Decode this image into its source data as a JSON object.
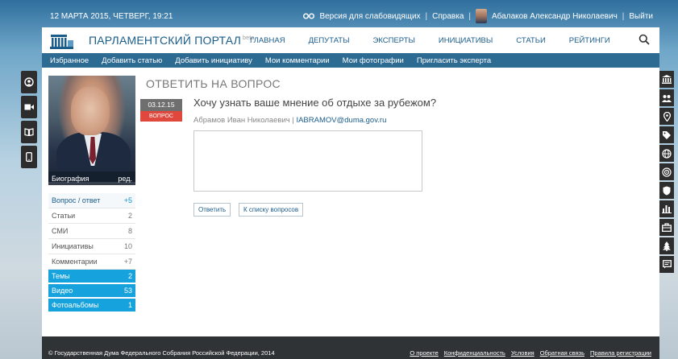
{
  "topbar": {
    "date": "12 МАРТА 2015, ЧЕТВЕРГ, 19:21",
    "low_vision": "Версия для слабовидящих",
    "help": "Справка",
    "user_name": "Абалаков Александр Николаевич",
    "logout": "Выйти",
    "separator": "|"
  },
  "header": {
    "title": "ПАРЛАМЕНТСКИЙ ПОРТАЛ",
    "beta": "beta",
    "nav": [
      "ГЛАВНАЯ",
      "ДЕПУТАТЫ",
      "ЭКСПЕРТЫ",
      "ИНИЦИАТИВЫ",
      "СТАТЬИ",
      "РЕЙТИНГИ"
    ]
  },
  "subnav": [
    "Избранное",
    "Добавить статью",
    "Добавить инициативу",
    "Мои комментарии",
    "Мои фотографии",
    "Пригласить эксперта"
  ],
  "profile": {
    "bio_label": "Биография",
    "edit_label": "ред.",
    "menu": [
      {
        "label": "Вопрос / ответ",
        "count": "+5"
      },
      {
        "label": "Статьи",
        "count": "2"
      },
      {
        "label": "СМИ",
        "count": "8"
      },
      {
        "label": "Инициативы",
        "count": "10"
      },
      {
        "label": "Комментарии",
        "count": "+7"
      },
      {
        "label": "Темы",
        "count": "2"
      },
      {
        "label": "Видео",
        "count": "53"
      },
      {
        "label": "Фотоальбомы",
        "count": "1"
      }
    ]
  },
  "main": {
    "heading": "ОТВЕТИТЬ НА ВОПРОС",
    "date": "03.12.15",
    "type": "ВОПРОС",
    "question": "Хочу узнать ваше мнение об отдыхе за рубежом?",
    "author": "Абрамов Иван Николаевич",
    "author_sep": " | ",
    "author_email": "IABRAMOV@duma.gov.ru",
    "answer_value": "",
    "answer_button": "Ответить",
    "back_button": "К списку вопросов"
  },
  "footer": {
    "copyright": "© Государственная Дума Федерального Собрания Российской Федерации, 2014",
    "links": [
      "О проекте",
      "Конфиденциальность",
      "Условия",
      "Обратная связь",
      "Правила регистрации"
    ]
  },
  "colors": {
    "brand_blue": "#1a5c8a",
    "subnav_bg": "#2e6b93",
    "accent_cyan": "#16a2dc",
    "badge_red": "#e0483d",
    "footer_bg": "#2f3335"
  },
  "icons": {
    "left_tools": [
      "person-circle-icon",
      "video-camera-icon",
      "book-icon",
      "mobile-phone-icon"
    ],
    "right_tools": [
      "parliament-icon",
      "people-group-icon",
      "location-pin-icon",
      "tags-icon",
      "globe-icon",
      "target-icon",
      "shield-icon",
      "bar-chart-icon",
      "briefcase-icon",
      "tree-icon",
      "message-icon"
    ]
  }
}
